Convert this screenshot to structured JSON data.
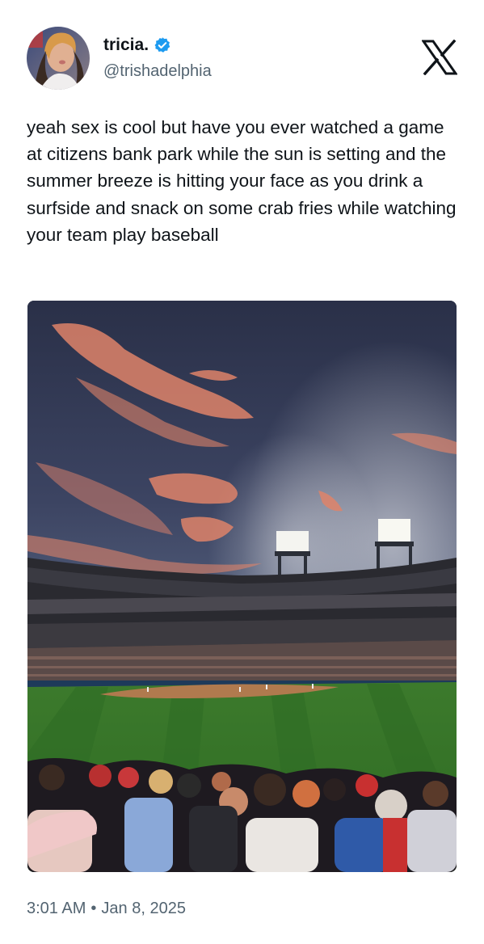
{
  "author": {
    "display_name": "tricia.",
    "handle": "@trishadelphia",
    "verified": true,
    "avatar_icon": "profile-photo"
  },
  "platform_logo_icon": "x-logo-icon",
  "tweet": {
    "text": "yeah sex is cool but have you ever watched a game at citizens bank park while the sun is setting and the summer breeze is hitting your face as you drink a surfside and snack on some crab fries while watching your team play baseball"
  },
  "media": {
    "alt_icon": "baseball-stadium-sunset-photo"
  },
  "meta": {
    "time": "3:01 AM",
    "separator": "•",
    "date": "Jan 8, 2025"
  },
  "colors": {
    "text_primary": "#0f1419",
    "text_secondary": "#536471",
    "verified_blue": "#1d9bf0"
  }
}
